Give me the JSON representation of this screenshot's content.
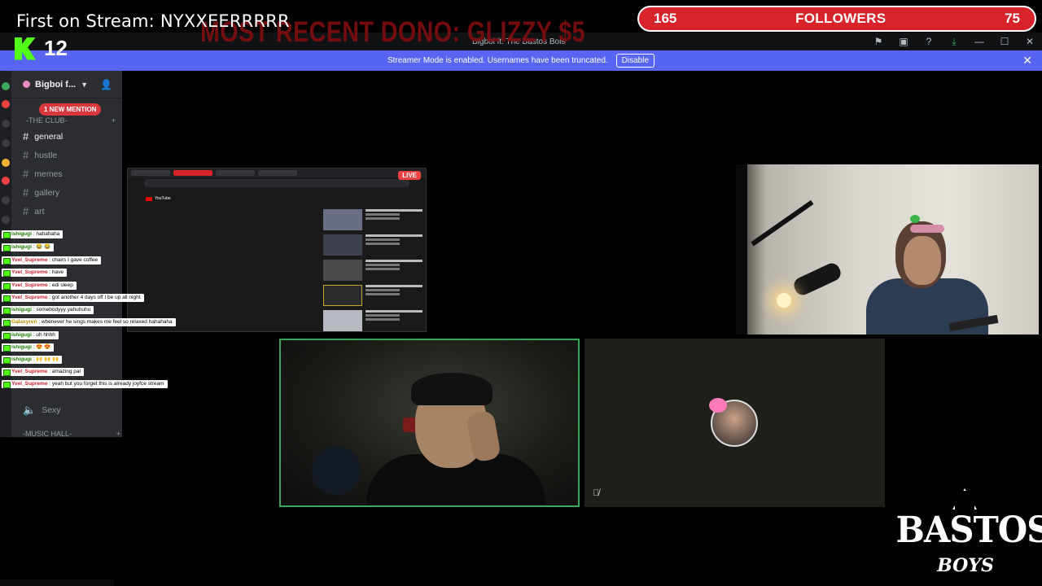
{
  "overlay": {
    "first_on_stream": "First on Stream: NYXXEERRRRR",
    "recent_dono": "MOST RECENT DONO: GLIZZY $5",
    "kick_viewers": "12",
    "followers": {
      "current": "165",
      "label": "FOLLOWERS",
      "goal": "75"
    }
  },
  "window": {
    "title": "Bigboi ft. The Bastos Bois",
    "icons": [
      "pin-icon",
      "inbox-icon",
      "help-icon",
      "download-icon",
      "minimize-icon",
      "maximize-icon",
      "close-icon"
    ]
  },
  "banner": {
    "text": "Streamer Mode is enabled. Usernames have been truncated.",
    "button": "Disable",
    "close": "✕"
  },
  "sidebar": {
    "server_name": "Bigboi f...",
    "mention_badge": "1 NEW MENTION",
    "category": "-THE CLUB-",
    "channels": [
      {
        "label": "general",
        "active": true
      },
      {
        "label": "hustle",
        "active": false
      },
      {
        "label": "memes",
        "active": false
      },
      {
        "label": "gallery",
        "active": false
      },
      {
        "label": "art",
        "active": false
      }
    ],
    "voice_channel": "Sexy",
    "music_category": "-MUSIC HALL-"
  },
  "chat": [
    {
      "user": "ishigugi",
      "msg": "hahahaha",
      "style": "alt"
    },
    {
      "user": "ishigugi",
      "msg": "😂 😂",
      "style": "alt"
    },
    {
      "user": "Yvel_Supreme",
      "msg": "chairs I gave coffee",
      "style": "red"
    },
    {
      "user": "Yvel_Supreme",
      "msg": "have",
      "style": "red"
    },
    {
      "user": "Yvel_Supreme",
      "msg": "edi sleep",
      "style": "red"
    },
    {
      "user": "Yvel_Supreme",
      "msg": "got another 4 days off I be up all night",
      "style": "red"
    },
    {
      "user": "ishigugi",
      "msg": "somebodyyy yahuhuhu",
      "style": "alt"
    },
    {
      "user": "Galaxyren",
      "msg": "whenever he sings makes me feel so relaxed hahahaha",
      "style": "gal"
    },
    {
      "user": "ishigugi",
      "msg": "uh hhhh",
      "style": "alt"
    },
    {
      "user": "ishigugi",
      "msg": "😍 😍",
      "style": "alt"
    },
    {
      "user": "ishigugi",
      "msg": "🙌 🙌 🙌",
      "style": "alt"
    },
    {
      "user": "Yvel_Supreme",
      "msg": "amazing pal",
      "style": "red"
    },
    {
      "user": "Yvel_Supreme",
      "msg": "yeah but you forget this is already joyfce stream",
      "style": "red"
    }
  ],
  "screenshare": {
    "live_badge": "LIVE",
    "site": "YouTube"
  },
  "logo": {
    "main": "BASTOS",
    "sub": "BOYS"
  }
}
